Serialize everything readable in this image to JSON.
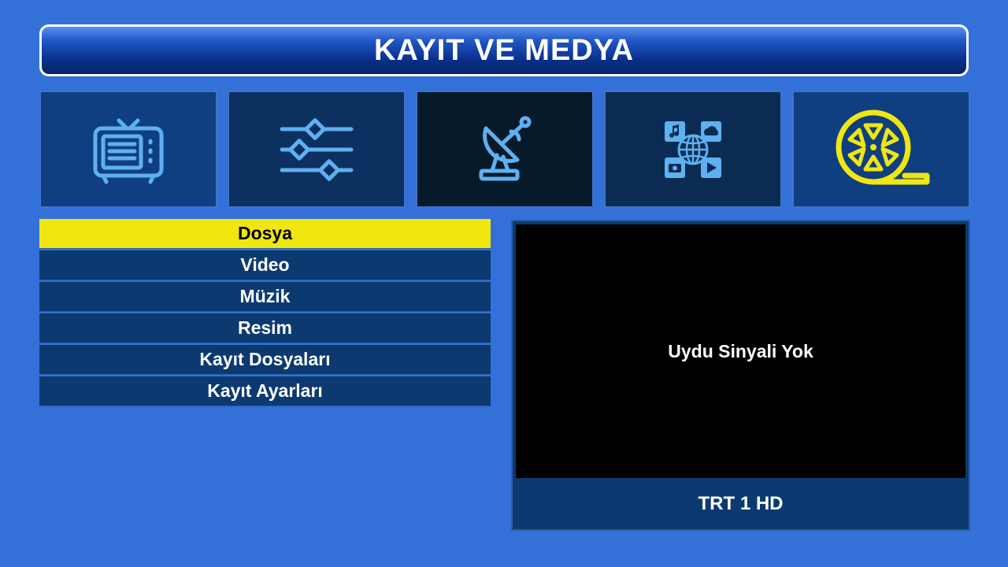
{
  "header": {
    "title": "KAYIT VE MEDYA"
  },
  "categories": [
    {
      "icon": "tv-icon",
      "selected": false
    },
    {
      "icon": "settings-sliders-icon",
      "selected": false
    },
    {
      "icon": "satellite-dish-icon",
      "selected": false
    },
    {
      "icon": "network-media-icon",
      "selected": false
    },
    {
      "icon": "film-reel-icon",
      "selected": true
    }
  ],
  "menu": {
    "items": [
      {
        "label": "Dosya",
        "selected": true
      },
      {
        "label": "Video",
        "selected": false
      },
      {
        "label": "Müzik",
        "selected": false
      },
      {
        "label": "Resim",
        "selected": false
      },
      {
        "label": "Kayıt Dosyaları",
        "selected": false
      },
      {
        "label": "Kayıt Ayarları",
        "selected": false
      }
    ]
  },
  "preview": {
    "message": "Uydu Sinyali Yok",
    "channel": "TRT 1 HD"
  },
  "colors": {
    "background": "#3370d8",
    "accent_selected": "#f0e610",
    "icon_blue": "#5fb0f0",
    "icon_yellow": "#f0e610"
  }
}
